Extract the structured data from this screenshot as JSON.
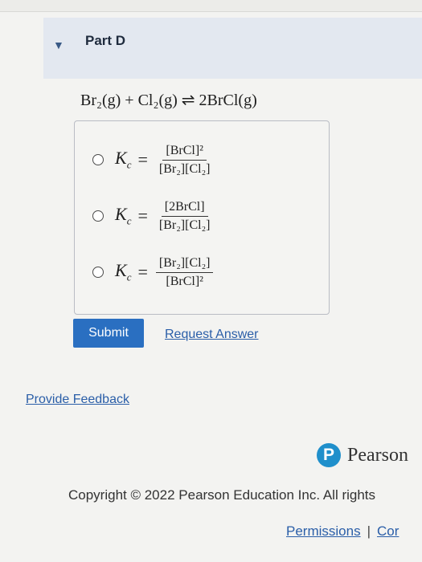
{
  "part": {
    "title": "Part D"
  },
  "equation": "Br₂(g) + Cl₂(g) ⇌ 2BrCl(g)",
  "choices": [
    {
      "lhs_var": "K",
      "lhs_sub": "c",
      "num": "[BrCl]²",
      "den": "[Br₂][Cl₂]"
    },
    {
      "lhs_var": "K",
      "lhs_sub": "c",
      "num": "[2BrCl]",
      "den": "[Br₂][Cl₂]"
    },
    {
      "lhs_var": "K",
      "lhs_sub": "c",
      "num": "[Br₂][Cl₂]",
      "den": "[BrCl]²"
    }
  ],
  "buttons": {
    "submit": "Submit",
    "request_answer": "Request Answer"
  },
  "feedback": "Provide Feedback",
  "brand": {
    "mark": "P",
    "name": "Pearson",
    "color": "#1f8fcb"
  },
  "footer": {
    "copyright": "Copyright © 2022 Pearson Education Inc. All rights",
    "permissions": "Permissions",
    "separator": "|",
    "contact": "Cor"
  }
}
